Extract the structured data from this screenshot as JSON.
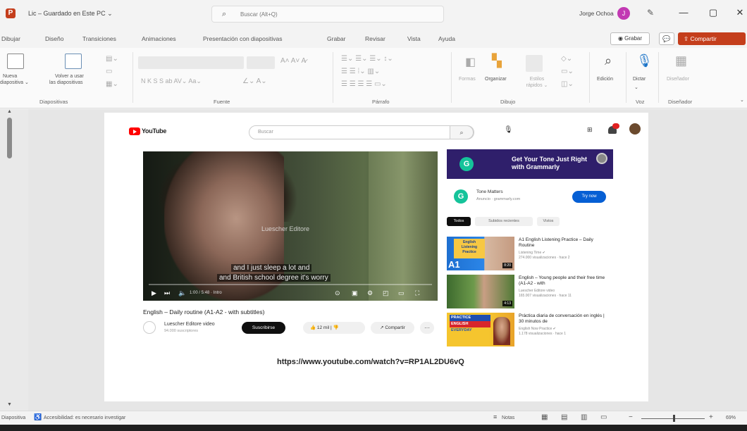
{
  "titlebar": {
    "app_icon_letter": "P",
    "doc_title": "Lic – Guardado en Este PC ⌄",
    "search_placeholder": "Buscar (Alt+Q)",
    "user_name": "Jorge Ochoa",
    "user_initial": "J",
    "minimize": "—",
    "maximize": "▢",
    "close": "✕"
  },
  "tabs": [
    "Dibujar",
    "Diseño",
    "Transiciones",
    "Animaciones",
    "Presentación con diapositivas",
    "Grabar",
    "Revisar",
    "Vista",
    "Ayuda"
  ],
  "tab_buttons": {
    "record": "Grabar",
    "comments": "💬",
    "share": "Compartir"
  },
  "ribbon": {
    "slides_group": {
      "new_slide": [
        "Nueva",
        "diapositiva ⌄"
      ],
      "reuse": [
        "Volver a usar",
        "las diapositivas"
      ],
      "label": "Diapositivas"
    },
    "font_group": {
      "letters": "N  K  S  S  ab  AV⌄  Aa⌄",
      "label": "Fuente"
    },
    "paragraph_group": {
      "label": "Párrafo"
    },
    "drawing_group": {
      "shapes": "Formas",
      "arrange": "Organizar",
      "quick_styles": "Estilos rápidos ⌄",
      "label": "Dibujo"
    },
    "edit_group": {
      "edit": "Edición"
    },
    "voice_group": {
      "dictate": "Dictar",
      "label": "Voz"
    },
    "designer_group": {
      "designer": "Diseñador",
      "label": "Diseñador"
    }
  },
  "slide": {
    "youtube": {
      "logo_text": "YouTube",
      "search_placeholder": "Buscar",
      "video": {
        "watermark": "Luescher Editore",
        "subtitle_line1": "and I just sleep a lot and",
        "subtitle_line2": "and British school degree it's worry",
        "progress": 0.0,
        "time": "1:00 / 5:48 · Intro"
      },
      "video_title": "English – Daily routine (A1-A2 - with subtitles)",
      "channel_name": "Luescher Editore video",
      "channel_subs": "94.000 suscriptores",
      "subscribe_label": "Suscribirse",
      "likes_label": "👍 12 mil  |  👎",
      "share_label": "↗ Compartir",
      "more_label": "···",
      "ad": {
        "banner_logo": "G",
        "banner_text": [
          "Get Your Tone Just Right",
          "with Grammarly"
        ],
        "card_logo": "G",
        "card_name": "Tone Matters",
        "card_sponsor": "Anuncio · grammarly.com",
        "try_label": "Try now"
      },
      "chips": [
        "Todos",
        "Subidos recientes",
        "Vistos"
      ],
      "recommendations": [
        {
          "title": "A1 English Listening Practice – Daily Routine",
          "meta": [
            "Listening Time ✔",
            "274.000 visualizaciones · hace 2"
          ],
          "duration": "8:20",
          "thumb_text": [
            "English",
            "Listening",
            "Practice"
          ],
          "thumb_badge": "A1"
        },
        {
          "title": "English – Young people and their free time (A1-A2 - with",
          "meta": [
            "Luescher Editore video",
            "165.007 visualizaciones · hace 11"
          ],
          "duration": "4:13"
        },
        {
          "title": "Práctica diaria de conversación en inglés | 30 minutos de",
          "meta": [
            "English Now Practice ✔",
            "1.178 visualizaciones · hace 1"
          ],
          "duration": "",
          "thumb_text": [
            "PRACTICE",
            "ENGLISH",
            "EVERYDAY"
          ]
        }
      ]
    },
    "url": "https://www.youtube.com/watch?v=RP1AL2DU6vQ"
  },
  "statusbar": {
    "slide_label": "Diapositiva",
    "accessibility": "Accesibilidad: es necesario investigar",
    "notes": "Notas",
    "zoom": "69%"
  },
  "colors": {
    "accent": "#c43e1c",
    "youtube_red": "#ff0000",
    "grammarly_purple": "#2f1f6b",
    "grammarly_green": "#15c39a",
    "yt_blue": "#065fd4"
  }
}
